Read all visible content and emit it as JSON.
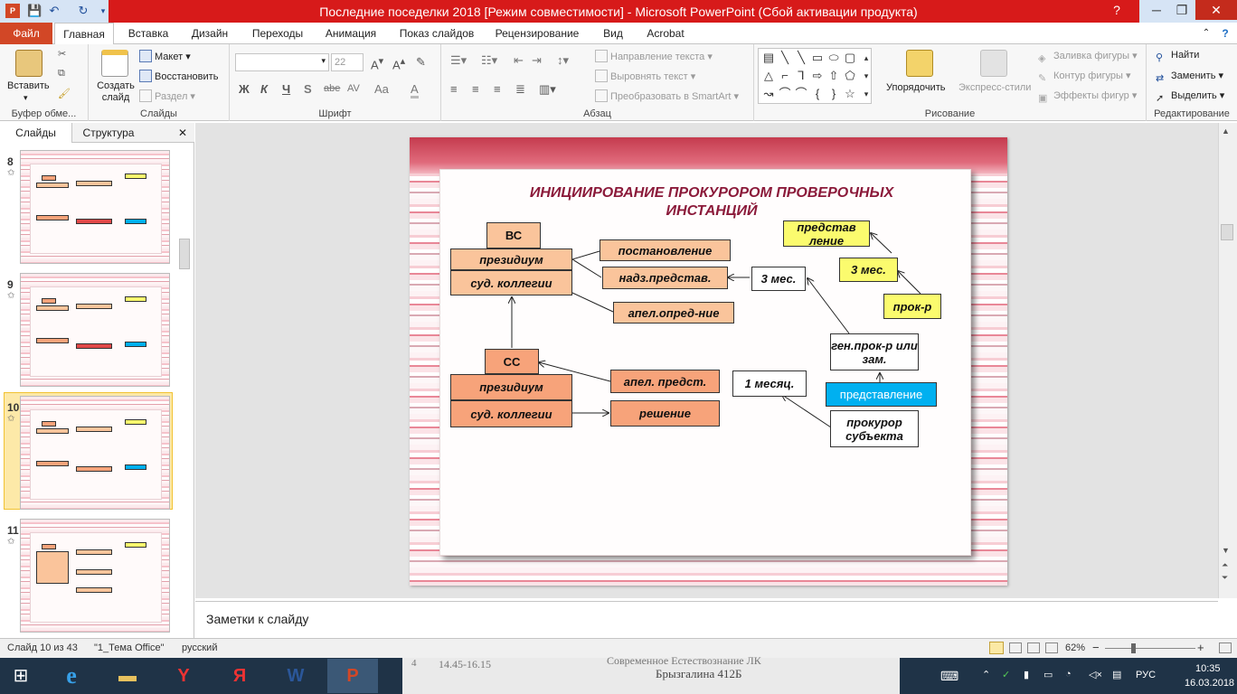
{
  "window": {
    "title": "Последние поседелки 2018 [Режим совместимости] - Microsoft PowerPoint (Сбой активации продукта)",
    "help": "?",
    "minimize": "─",
    "restore": "❐",
    "close": "✕"
  },
  "tabs": [
    {
      "label": "Файл"
    },
    {
      "label": "Главная"
    },
    {
      "label": "Вставка"
    },
    {
      "label": "Дизайн"
    },
    {
      "label": "Переходы"
    },
    {
      "label": "Анимация"
    },
    {
      "label": "Показ слайдов"
    },
    {
      "label": "Рецензирование"
    },
    {
      "label": "Вид"
    },
    {
      "label": "Acrobat"
    }
  ],
  "ribbon": {
    "clipboard": {
      "paste": "Вставить",
      "label": "Буфер обме..."
    },
    "slides": {
      "new_slide": "Создать слайд",
      "layout": "Макет",
      "reset": "Восстановить",
      "section": "Раздел",
      "label": "Слайды"
    },
    "font": {
      "size": "22",
      "bold": "Ж",
      "italic": "К",
      "underline": "Ч",
      "shadow": "S",
      "strike": "abe",
      "spacing": "AV",
      "case": "Aa",
      "color": "A",
      "label": "Шрифт"
    },
    "paragraph": {
      "text_dir": "Направление текста",
      "align_text": "Выровнять текст",
      "smartart": "Преобразовать в SmartArt",
      "label": "Абзац"
    },
    "drawing": {
      "arrange": "Упорядочить",
      "quick_styles": "Экспресс-стили",
      "fill": "Заливка фигуры",
      "outline": "Контур фигуры",
      "effects": "Эффекты фигур",
      "label": "Рисование"
    },
    "editing": {
      "find": "Найти",
      "replace": "Заменить",
      "select": "Выделить",
      "label": "Редактирование"
    }
  },
  "left_panel": {
    "tab_slides": "Слайды",
    "tab_outline": "Структура",
    "close": "✕",
    "thumbnails": [
      {
        "num": "8"
      },
      {
        "num": "9"
      },
      {
        "num": "10"
      },
      {
        "num": "11"
      }
    ]
  },
  "slide": {
    "title_line1": "ИНИЦИИРОВАНИЕ   ПРОКУРОРОМ  ПРОВЕРОЧНЫХ",
    "title_line2": "ИНСТАНЦИЙ",
    "vs": "ВС",
    "vs_presidium": "президиум",
    "vs_sud": "суд. коллегии",
    "postanovlenie": "постановление",
    "nadz": "надз.представ.",
    "apel_opred": "апел.опред-ние",
    "three_mes_white": "3 мес.",
    "predstavlenie_yel": "представ ление",
    "three_mes_yel": "3 мес.",
    "prok_r": "прок-р",
    "gen_prok": "ген.прок-р или зам.",
    "predstavlenie_blue": "представление",
    "prokuror_subj": "прокурор субъекта",
    "ss": "СС",
    "ss_presidium": "президиум",
    "ss_sud": "суд. коллегии",
    "apel_predst": "апел. предст.",
    "one_month": "1 месяц.",
    "reshenie": "решение"
  },
  "notes": {
    "placeholder": "Заметки к слайду"
  },
  "status": {
    "slide": "Слайд 10 из 43",
    "theme": "\"1_Тема Office\"",
    "lang": "русский",
    "zoom": "62%",
    "zoom_minus": "−",
    "zoom_plus": "+"
  },
  "taskbar": {
    "lang": "РУС",
    "time": "10:35",
    "date": "16.03.2018",
    "bg_text1": "14.45-16.15",
    "bg_text2": "Современное Естествознание ЛК",
    "bg_text3": "Брызгалина 412Б",
    "bg_num": "4"
  },
  "colors": {
    "title_red": "#d71a1a",
    "file_tab": "#d24726",
    "salmon": "#f7a37a",
    "yellow": "#fbfb6e",
    "blue": "#00b0f0",
    "slide_title": "#8b1a3a",
    "taskbar": "#1f3347"
  }
}
